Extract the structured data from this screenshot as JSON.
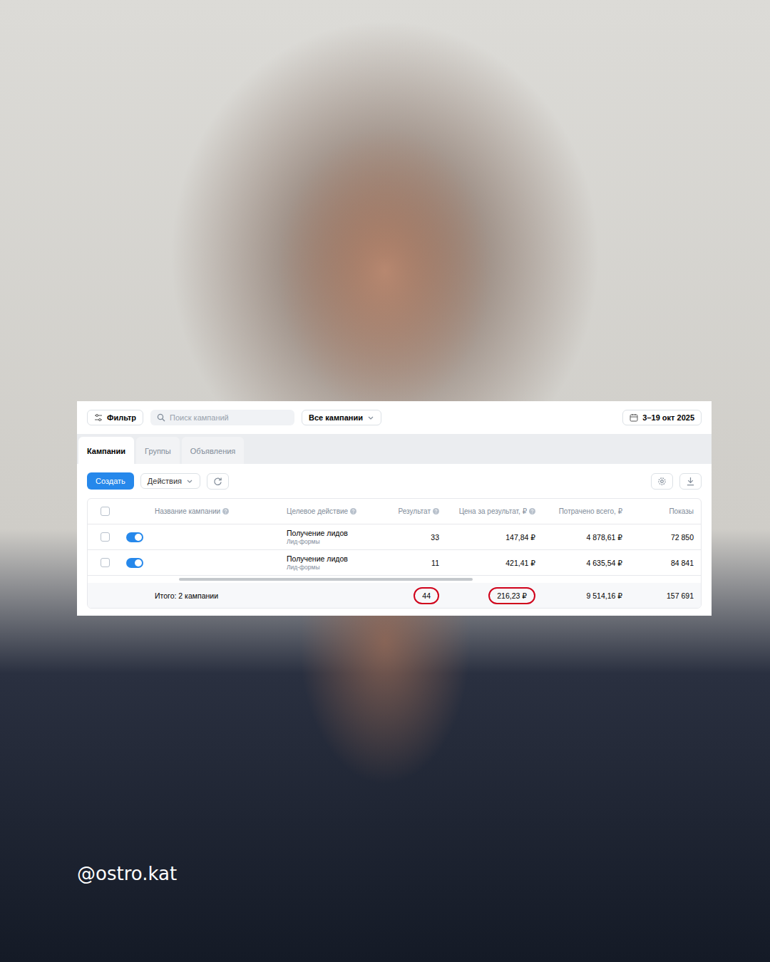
{
  "watermark": "@ostro.kat",
  "toolbar": {
    "filter": "Фильтр",
    "search_placeholder": "Поиск кампаний",
    "dropdown": "Все кампании",
    "date": "3–19 окт 2025"
  },
  "tabs": [
    {
      "label": "Кампании",
      "selected": true
    },
    {
      "label": "Группы",
      "selected": false
    },
    {
      "label": "Объявления",
      "selected": false
    }
  ],
  "actions": {
    "create": "Создать",
    "menu": "Действия"
  },
  "table": {
    "header_checked": false,
    "columns": [
      {
        "label": "Название кампании",
        "help": true
      },
      {
        "label": "Целевое действие",
        "help": true
      },
      {
        "label": "Результат",
        "help": true
      },
      {
        "label": "Цена за результат, ₽",
        "help": true
      },
      {
        "label": "Потрачено всего, ₽",
        "help": false
      },
      {
        "label": "Показы",
        "help": false
      }
    ],
    "rows": [
      {
        "checked": false,
        "enabled": true,
        "action": "Получение лидов",
        "action_sub": "Лид-формы",
        "result": "33",
        "price": "147,84 ₽",
        "spent": "4 878,61 ₽",
        "shows": "72 850"
      },
      {
        "checked": false,
        "enabled": true,
        "action": "Получение лидов",
        "action_sub": "Лид-формы",
        "result": "11",
        "price": "421,41 ₽",
        "spent": "4 635,54 ₽",
        "shows": "84 841"
      }
    ],
    "total": {
      "label": "Итого: 2 кампании",
      "cells": [
        {
          "text": "44",
          "highlighted": true
        },
        {
          "text": "216,23 ₽",
          "highlighted": true
        },
        {
          "text": "9 514,16 ₽",
          "highlighted": false
        },
        {
          "text": "157 691",
          "highlighted": false
        }
      ]
    }
  }
}
